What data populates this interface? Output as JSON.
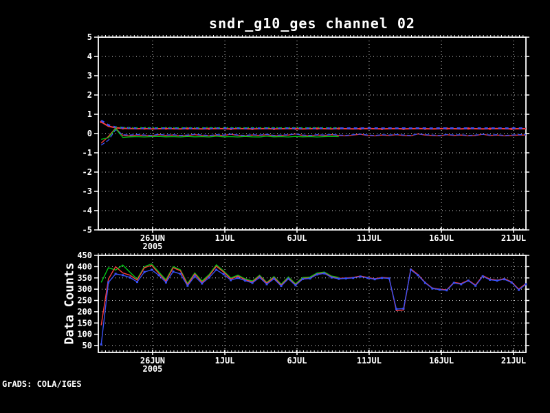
{
  "title": "sndr_g10_ges channel 02",
  "watermark": "GrADS: COLA/IGES",
  "colors": {
    "background": "#000000",
    "frame": "#ffffff",
    "grid": "#dedede",
    "red": "#f83c3c",
    "green": "#00c814",
    "blue": "#3850f5"
  },
  "chart_data": [
    {
      "type": "line",
      "panel": "bias-panel",
      "title": "sndr_g10_ges channel 02",
      "xlabel": "",
      "ylabel": "",
      "ylim": [
        -5,
        5
      ],
      "yticks": [
        5,
        4,
        3,
        2,
        1,
        0,
        -1,
        -2,
        -3,
        -4,
        -5
      ],
      "xlim_days": [
        0,
        29.7
      ],
      "xtick_days": [
        3.77,
        8.79,
        13.8,
        18.81,
        23.83,
        28.84
      ],
      "xtick_labels": [
        "26JUN",
        "1JUL",
        "6JUL",
        "11JUL",
        "16JUL",
        "21JUL"
      ],
      "year_label": "2005",
      "grid": "dotted",
      "legend": "none",
      "x_start_day": 0.2,
      "x_step_days": 0.5,
      "series": [
        {
          "name": "red-top-line",
          "color": "red",
          "dash": "",
          "width": 2,
          "marker": true,
          "marker_step": 3,
          "values": [
            0.6,
            0.38,
            0.3,
            0.27,
            0.26,
            0.25,
            0.26,
            0.24,
            0.25,
            0.26,
            0.25,
            0.24,
            0.26,
            0.25,
            0.24,
            0.25,
            0.26,
            0.25,
            0.24,
            0.26,
            0.25,
            0.24,
            0.25,
            0.26,
            0.24,
            0.25,
            0.26,
            0.25,
            0.24,
            0.25,
            0.26,
            0.25,
            0.24,
            0.26,
            0.25,
            0.24,
            0.25,
            0.26,
            0.25,
            0.24,
            0.25,
            0.26,
            0.24,
            0.25,
            0.26,
            0.25,
            0.24,
            0.25,
            0.26,
            0.25,
            0.24,
            0.26,
            0.25,
            0.24,
            0.25,
            0.26,
            0.25,
            0.24,
            0.25,
            0.25
          ]
        },
        {
          "name": "blue-top-line",
          "color": "blue",
          "dash": "5 5",
          "width": 2.5,
          "marker": false,
          "marker_step": 0,
          "values": [
            0.68,
            0.44,
            0.33,
            0.3,
            0.29,
            0.28,
            0.27,
            0.28,
            0.27,
            0.28,
            0.28,
            0.27,
            0.28,
            0.27,
            0.28,
            0.27,
            0.28,
            0.28,
            0.27,
            0.28,
            0.27,
            0.28,
            0.27,
            0.28,
            0.28,
            0.27,
            0.28,
            0.27,
            0.28,
            0.27,
            0.28,
            0.28,
            0.27,
            0.28,
            0.27,
            0.28,
            0.27,
            0.28,
            0.28,
            0.27,
            0.28,
            0.27,
            0.28,
            0.27,
            0.28,
            0.28,
            0.27,
            0.28,
            0.27,
            0.28,
            0.27,
            0.28,
            0.28,
            0.27,
            0.28,
            0.27,
            0.28,
            0.27,
            0.28,
            0.28
          ]
        },
        {
          "name": "green-top-line",
          "color": "green",
          "dash": "2 4",
          "width": 1.5,
          "marker": false,
          "marker_step": 0,
          "values": [
            null,
            null,
            0.32,
            0.31,
            0.3,
            0.3,
            0.31,
            0.3,
            0.3,
            0.31,
            0.3,
            0.3,
            0.31,
            0.3,
            0.3,
            0.31,
            0.3,
            0.3,
            0.31,
            0.3,
            0.3,
            0.31,
            0.3,
            0.3,
            0.31,
            0.3,
            0.3,
            0.31,
            0.3,
            0.3,
            0.31,
            0.3,
            0.3,
            0.3,
            null,
            null,
            null,
            null,
            null,
            null,
            null,
            null,
            null,
            null,
            null,
            null,
            null,
            null,
            null,
            null,
            null,
            null,
            null,
            null,
            null,
            null,
            null,
            null,
            null,
            null
          ]
        },
        {
          "name": "red-mid-line",
          "color": "red",
          "dash": "",
          "width": 1.3,
          "marker": false,
          "marker_step": 0,
          "values": [
            -0.5,
            -0.15,
            0.28,
            -0.1,
            -0.12,
            -0.08,
            -0.1,
            -0.12,
            -0.06,
            -0.1,
            -0.08,
            -0.12,
            -0.1,
            -0.06,
            -0.1,
            -0.12,
            -0.08,
            -0.1,
            -0.04,
            -0.1,
            -0.12,
            -0.08,
            -0.1,
            -0.06,
            -0.12,
            -0.1,
            -0.08,
            -0.02,
            -0.1,
            -0.12,
            -0.08,
            -0.1,
            -0.06,
            -0.1,
            -0.12,
            -0.08,
            -0.04,
            -0.1,
            -0.12,
            -0.08,
            -0.1,
            -0.06,
            -0.1,
            -0.12,
            -0.02,
            -0.08,
            -0.1,
            -0.12,
            -0.06,
            -0.1,
            -0.08,
            -0.12,
            -0.1,
            -0.04,
            -0.1,
            -0.08,
            -0.12,
            -0.1,
            -0.08,
            -0.08
          ]
        },
        {
          "name": "blue-mid-line",
          "color": "blue",
          "dash": "6 3",
          "width": 1.3,
          "marker": false,
          "marker_step": 0,
          "values": [
            -0.6,
            -0.35,
            0.2,
            -0.06,
            -0.08,
            -0.05,
            -0.08,
            -0.1,
            -0.04,
            -0.08,
            -0.06,
            -0.1,
            -0.08,
            -0.04,
            -0.08,
            -0.1,
            -0.06,
            -0.08,
            -0.03,
            -0.08,
            -0.1,
            -0.06,
            -0.08,
            -0.04,
            -0.1,
            -0.08,
            -0.06,
            -0.02,
            -0.08,
            -0.1,
            -0.06,
            -0.08,
            -0.05,
            -0.08,
            -0.1,
            -0.06,
            -0.03,
            -0.08,
            -0.1,
            -0.06,
            -0.08,
            -0.05,
            -0.08,
            -0.1,
            -0.02,
            -0.06,
            -0.08,
            -0.1,
            -0.05,
            -0.08,
            -0.06,
            -0.1,
            -0.08,
            -0.04,
            -0.08,
            -0.06,
            -0.1,
            -0.08,
            -0.06,
            -0.06
          ]
        },
        {
          "name": "green-mid-line",
          "color": "green",
          "dash": "",
          "width": 1.3,
          "marker": false,
          "marker_step": 0,
          "values": [
            -0.3,
            -0.22,
            0.26,
            -0.2,
            -0.17,
            -0.16,
            -0.18,
            -0.16,
            -0.15,
            -0.17,
            -0.16,
            -0.18,
            -0.15,
            -0.17,
            -0.16,
            -0.18,
            -0.14,
            -0.17,
            -0.16,
            -0.18,
            -0.15,
            -0.17,
            -0.18,
            -0.14,
            -0.17,
            -0.16,
            -0.18,
            -0.15,
            -0.17,
            -0.16,
            -0.18,
            -0.16,
            -0.15,
            -0.16,
            null,
            null,
            null,
            null,
            null,
            null,
            null,
            null,
            null,
            null,
            null,
            null,
            null,
            null,
            null,
            null,
            null,
            null,
            null,
            null,
            null,
            null,
            null,
            null,
            null,
            null
          ]
        }
      ]
    },
    {
      "type": "line",
      "panel": "counts-panel",
      "title": "",
      "xlabel": "",
      "ylabel": "Data Counts",
      "ylim": [
        19.5,
        450
      ],
      "yticks": [
        450,
        400,
        350,
        300,
        250,
        200,
        150,
        100,
        50
      ],
      "xlim_days": [
        0,
        29.7
      ],
      "xtick_days": [
        3.77,
        8.79,
        13.8,
        18.81,
        23.83,
        28.84
      ],
      "xtick_labels": [
        "26JUN",
        "1JUL",
        "6JUL",
        "11JUL",
        "16JUL",
        "21JUL"
      ],
      "year_label": "2005",
      "grid": "dotted",
      "legend": "none",
      "x_start_day": 0.2,
      "x_step_days": 0.5,
      "series": [
        {
          "name": "counts-green-line",
          "color": "green",
          "dash": "",
          "width": 1.4,
          "marker": false,
          "marker_step": 0,
          "values": [
            330,
            395,
            385,
            407,
            375,
            345,
            400,
            412,
            376,
            342,
            400,
            386,
            325,
            372,
            336,
            365,
            408,
            381,
            350,
            362,
            346,
            336,
            362,
            330,
            356,
            322,
            354,
            324,
            352,
            354,
            372,
            376,
            358,
            352,
            null,
            null,
            null,
            null,
            null,
            null,
            null,
            null,
            null,
            null,
            null,
            null,
            null,
            null,
            null,
            null,
            null,
            null,
            null,
            null,
            null,
            null,
            null,
            null,
            null,
            null
          ]
        },
        {
          "name": "counts-red-line",
          "color": "red",
          "dash": "",
          "width": 1.4,
          "marker": false,
          "marker_step": 0,
          "values": [
            140,
            345,
            400,
            372,
            362,
            340,
            395,
            406,
            370,
            336,
            395,
            382,
            320,
            368,
            330,
            360,
            402,
            376,
            345,
            358,
            342,
            332,
            358,
            327,
            352,
            318,
            350,
            320,
            348,
            350,
            368,
            372,
            355,
            348,
            350,
            352,
            358,
            352,
            346,
            352,
            350,
            205,
            208,
            390,
            365,
            330,
            305,
            300,
            297,
            330,
            325,
            340,
            318,
            360,
            345,
            340,
            347,
            332,
            300,
            325
          ]
        },
        {
          "name": "counts-blue-line",
          "color": "blue",
          "dash": "",
          "width": 1.4,
          "marker": true,
          "marker_step": 1,
          "values": [
            55,
            330,
            368,
            362,
            352,
            332,
            376,
            386,
            362,
            330,
            378,
            368,
            315,
            358,
            325,
            352,
            386,
            366,
            340,
            350,
            338,
            328,
            352,
            322,
            346,
            314,
            346,
            317,
            345,
            348,
            365,
            370,
            352,
            346,
            348,
            350,
            356,
            350,
            344,
            350,
            348,
            212,
            214,
            386,
            362,
            328,
            303,
            298,
            295,
            328,
            322,
            338,
            315,
            357,
            342,
            338,
            344,
            330,
            297,
            322
          ]
        }
      ]
    }
  ],
  "layout_note": "two stacked GrADS time-series panels, black background, dotted white grid"
}
